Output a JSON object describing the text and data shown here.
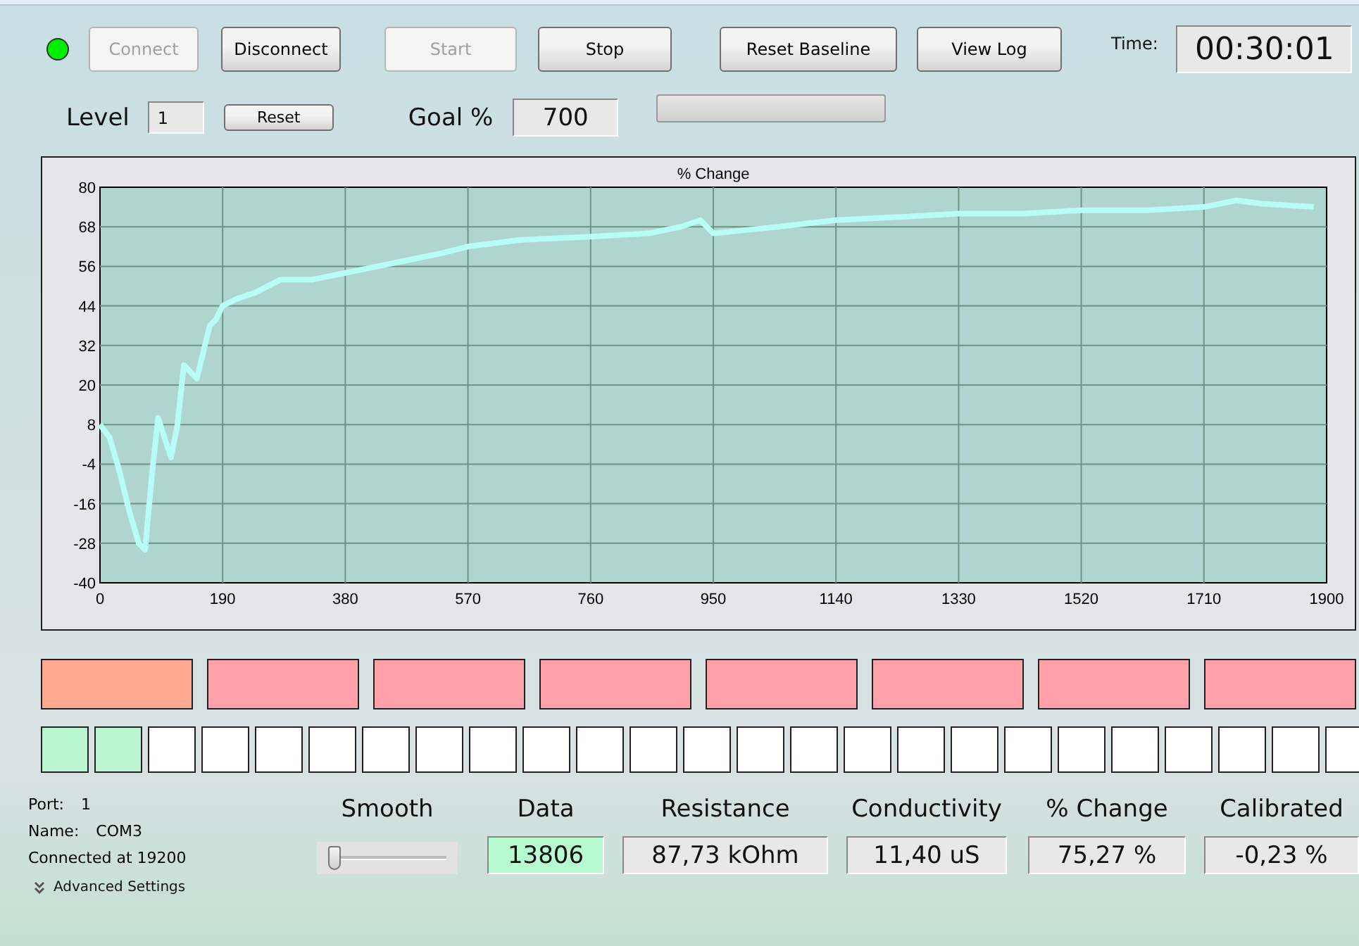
{
  "status_led": {
    "on": true
  },
  "top_buttons": [
    {
      "label": "Connect",
      "disabled": true
    },
    {
      "label": "Disconnect",
      "disabled": false
    },
    {
      "label": "Start",
      "disabled": true
    },
    {
      "label": "Stop",
      "disabled": false
    },
    {
      "label": "Reset Baseline",
      "disabled": false
    },
    {
      "label": "View Log",
      "disabled": false
    }
  ],
  "time": {
    "label": "Time:",
    "value": "00:30:01"
  },
  "level": {
    "label": "Level",
    "value": "1",
    "button": "Reset"
  },
  "goal": {
    "label": "Goal %",
    "value": "700"
  },
  "progress": {
    "level": 0
  },
  "chart": {
    "chart_data": {
      "type": "line",
      "title": "% Change",
      "grid": true,
      "xlim": [
        0,
        1900
      ],
      "ylim": [
        -40,
        80
      ],
      "xticks": [
        0,
        190,
        380,
        570,
        760,
        950,
        1140,
        1330,
        1520,
        1710,
        1900
      ],
      "yticks": [
        -40,
        -28,
        -16,
        -4,
        8,
        20,
        32,
        44,
        56,
        68,
        80
      ],
      "x": [
        0,
        15,
        30,
        45,
        60,
        70,
        80,
        90,
        100,
        110,
        120,
        130,
        140,
        150,
        160,
        170,
        180,
        190,
        210,
        240,
        280,
        330,
        380,
        430,
        480,
        530,
        570,
        650,
        760,
        850,
        900,
        930,
        950,
        1000,
        1050,
        1140,
        1240,
        1330,
        1430,
        1520,
        1620,
        1710,
        1760,
        1800,
        1880
      ],
      "series": [
        {
          "color": "#b8fcf6",
          "values": [
            8,
            4,
            -6,
            -18,
            -28,
            -30,
            -8,
            10,
            4,
            -2,
            8,
            26,
            24,
            22,
            30,
            38,
            40,
            44,
            46,
            48,
            52,
            52,
            54,
            56,
            58,
            60,
            62,
            64,
            65,
            66,
            68,
            70,
            66,
            67,
            68,
            70,
            71,
            72,
            72,
            73,
            73,
            74,
            76,
            75,
            74
          ]
        }
      ]
    }
  },
  "color_blocks": [
    {
      "color": "#ffaa90"
    },
    {
      "color": "#ffa0aa"
    },
    {
      "color": "#ffa0aa"
    },
    {
      "color": "#ffa0aa"
    },
    {
      "color": "#ffa0aa"
    },
    {
      "color": "#ffa0aa"
    },
    {
      "color": "#ffa0aa"
    },
    {
      "color": "#ffa0aa"
    }
  ],
  "squares": [
    {
      "on": true
    },
    {
      "on": true
    },
    {
      "on": false
    },
    {
      "on": false
    },
    {
      "on": false
    },
    {
      "on": false
    },
    {
      "on": false
    },
    {
      "on": false
    },
    {
      "on": false
    },
    {
      "on": false
    },
    {
      "on": false
    },
    {
      "on": false
    },
    {
      "on": false
    },
    {
      "on": false
    },
    {
      "on": false
    },
    {
      "on": false
    },
    {
      "on": false
    },
    {
      "on": false
    },
    {
      "on": false
    },
    {
      "on": false
    },
    {
      "on": false
    },
    {
      "on": false
    },
    {
      "on": false
    },
    {
      "on": false
    },
    {
      "on": false
    }
  ],
  "port_info": [
    {
      "label": "Port:",
      "value": "1"
    },
    {
      "label": "Name:",
      "value": "COM3"
    }
  ],
  "connection": "Connected at 19200",
  "advanced_settings": "Advanced Settings",
  "smooth": {
    "label": "Smooth",
    "level": 0.05
  },
  "readouts": [
    {
      "label": "Data",
      "value": "13806",
      "highlight": true
    },
    {
      "label": "Resistance",
      "value": "87,73 kOhm",
      "highlight": false
    },
    {
      "label": "Conductivity",
      "value": "11,40 uS",
      "highlight": false
    },
    {
      "label": "% Change",
      "value": "75,27 %",
      "highlight": false
    },
    {
      "label": "Calibrated",
      "value": "-0,23 %",
      "highlight": false
    }
  ]
}
